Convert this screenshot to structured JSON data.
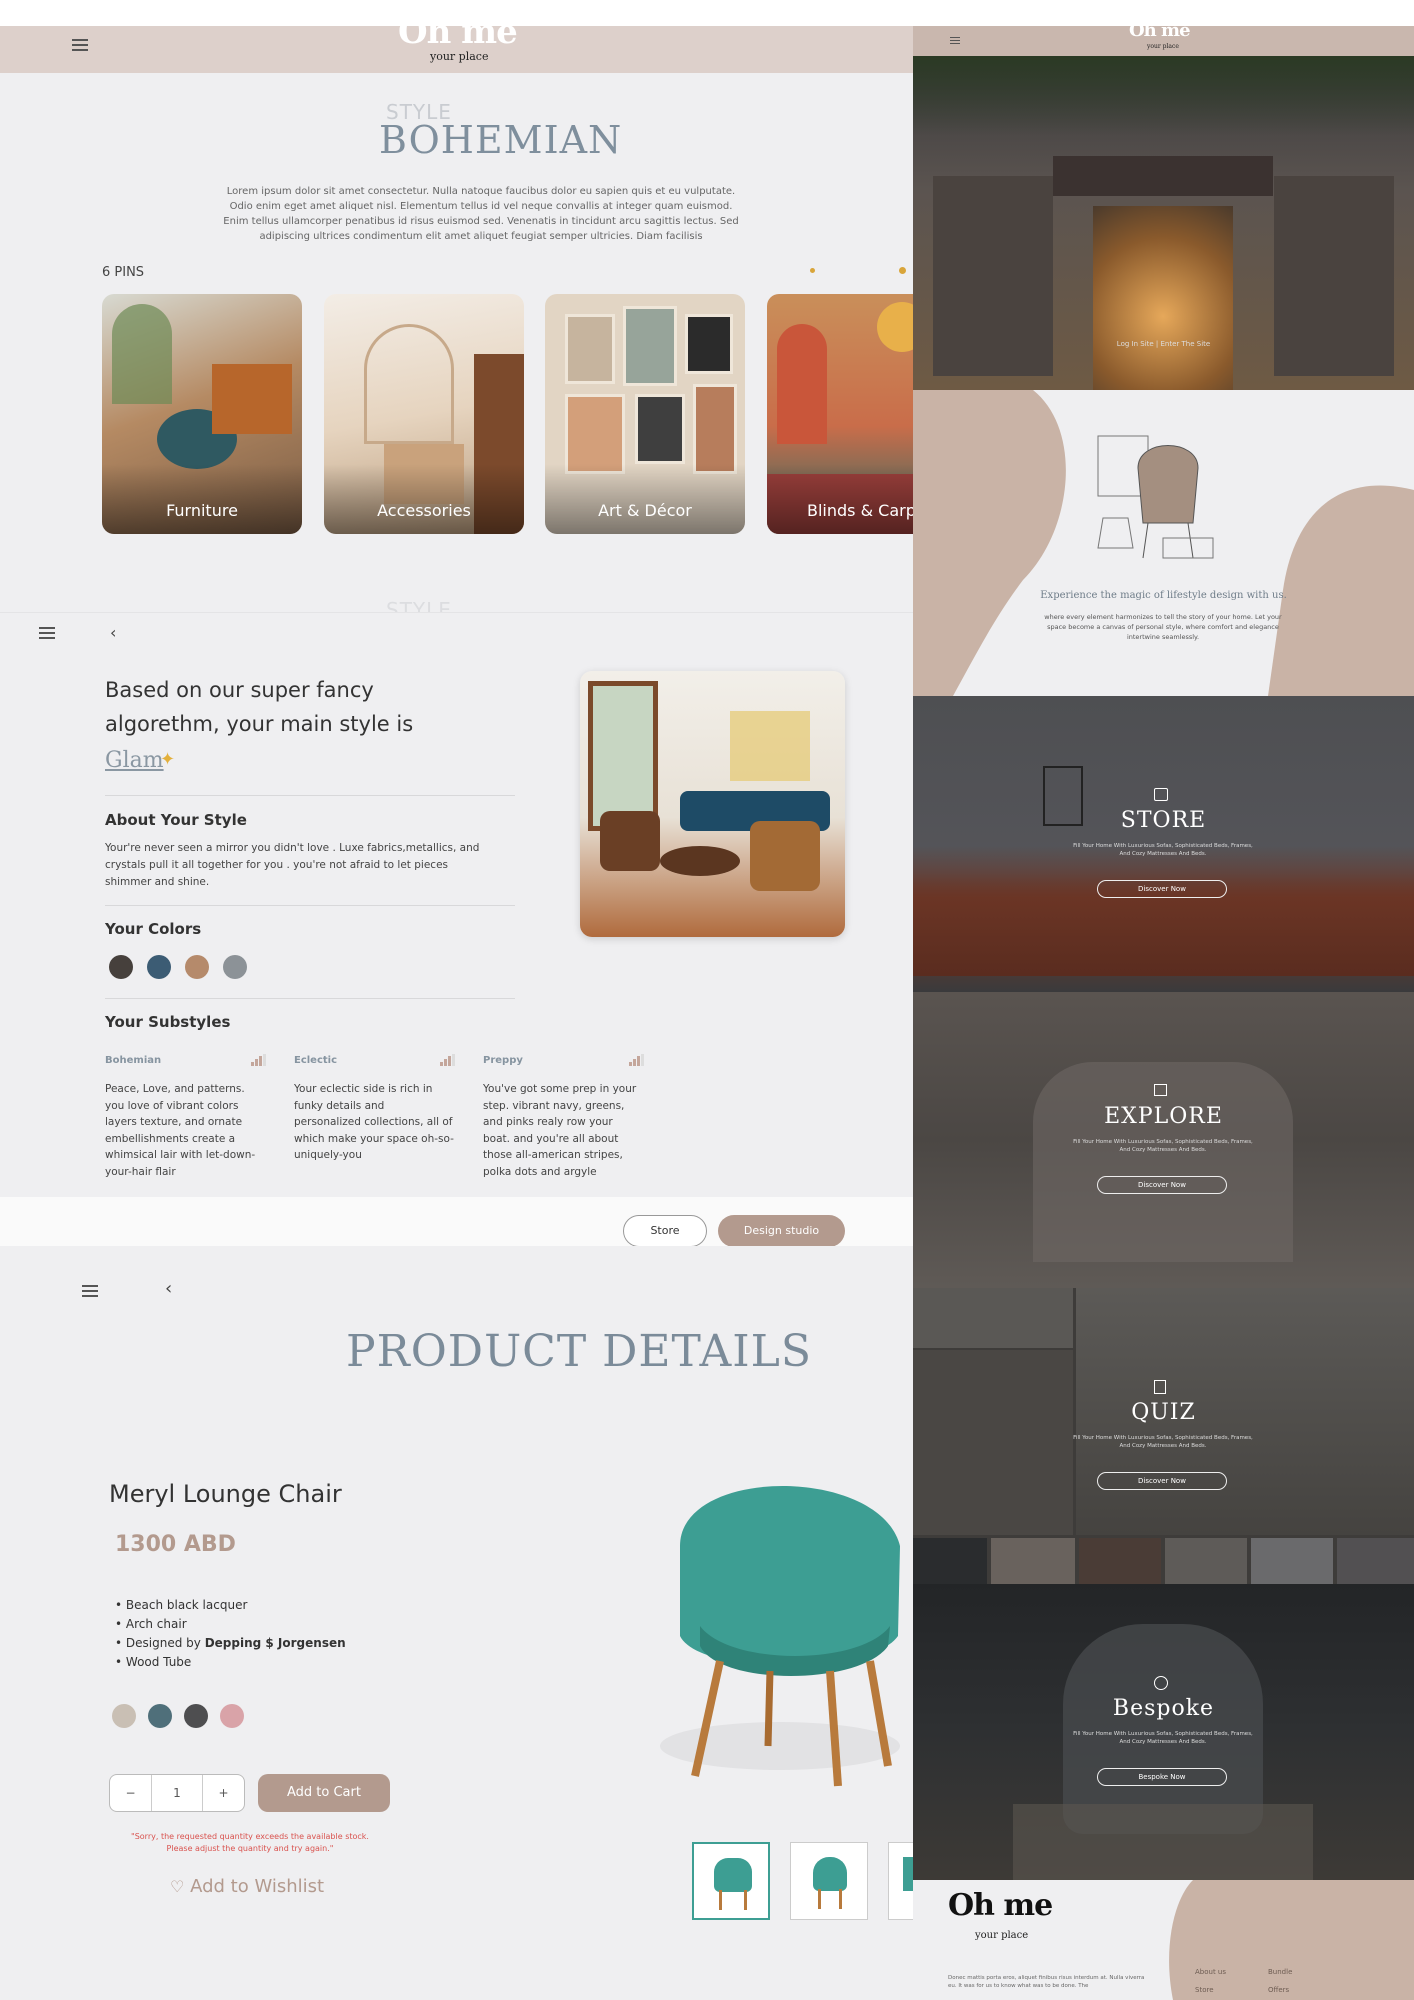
{
  "colors": {
    "accent": "#b39a8e",
    "title_blue": "#7f8f9d",
    "topbar": "#ddd0cb",
    "background": "#efeff1"
  },
  "bohemian": {
    "logo": "Oh me",
    "logo_sub": "your place",
    "style_label": "STYLE",
    "style_name": "BOHEMIAN",
    "description": "Lorem ipsum dolor sit amet consectetur. Nulla natoque faucibus dolor eu sapien quis et eu vulputate. Odio enim eget amet aliquet nisl. Elementum tellus id vel neque convallis at integer quam euismod. Enim tellus ullamcorper penatibus id risus euismod sed. Venenatis in tincidunt arcu sagittis lectus. Sed adipiscing ultrices condimentum elit amet aliquet feugiat semper ultricies. Diam facilisis",
    "pins_count": "6 PINS",
    "cards": [
      "Furniture",
      "Accessories",
      "Art & Décor",
      "Blinds & Carp"
    ],
    "style_label_faded": "STYLE"
  },
  "result": {
    "heading": "Based on our super fancy algorethm, your main style is",
    "style_name": "Glam",
    "about_title": "About Your Style",
    "about_text": "Your're never seen a mirror you didn't love . Luxe fabrics,metallics, and crystals pull it all together for you . you're not afraid to let pieces shimmer and shine.",
    "colors_title": "Your Colors",
    "swatches": [
      "#46403c",
      "#3c5c74",
      "#b58a6b",
      "#8c9297"
    ],
    "substyles_title": "Your Substyles",
    "substyles": [
      {
        "name": "Bohemian",
        "text": "Peace, Love, and patterns. you love of vibrant colors layers texture, and ornate embellishments create a whimsical lair with let-down-your-hair flair"
      },
      {
        "name": "Eclectic",
        "text": "Your eclectic side is rich in funky details and personalized collections, all of which make your space oh-so-uniquely-you"
      },
      {
        "name": "Preppy",
        "text": "You've got some prep in your step. vibrant navy, greens, and pinks realy row your boat. and you're all about those all-american stripes, polka dots and argyle"
      }
    ],
    "btn_store": "Store",
    "btn_design": "Design studio"
  },
  "product": {
    "page_title": "PRODUCT DETAILS",
    "name": "Meryl Lounge Chair",
    "price": "1300 ABD",
    "features": [
      "Beach black lacquer",
      "Arch chair",
      "Designed by",
      "Wood Tube"
    ],
    "designer": "Depping $ Jorgensen",
    "color_options": [
      "#c9bfb4",
      "#4f6f7a",
      "#4e4e50",
      "#d9a3a8"
    ],
    "qty_minus": "−",
    "qty_value": "1",
    "qty_plus": "+",
    "add_to_cart": "Add to Cart",
    "stock_message_1": "\"Sorry, the requested quantity exceeds the available stock.",
    "stock_message_2": "Please adjust the quantity and try again.\"",
    "wishlist": "Add to Wishlist"
  },
  "right": {
    "logo": "Oh me",
    "logo_sub": "your place",
    "hero_links": "Log In Site  |  Enter The Site",
    "about_heading": "Experience the magic of lifestyle design with us.",
    "about_text": "where every element harmonizes to tell the story of your home. Let your space become a canvas of personal style, where comfort and elegance intertwine seamlessly.",
    "sections": [
      {
        "title": "STORE",
        "sub": "Fill Your Home With Luxurious Sofas, Sophisticated Beds, Frames, And Cozy Mattresses And Beds.",
        "button": "Discover Now"
      },
      {
        "title": "EXPLORE",
        "sub": "Fill Your Home With Luxurious Sofas, Sophisticated Beds, Frames, And Cozy Mattresses And Beds.",
        "button": "Discover Now"
      },
      {
        "title": "QUIZ",
        "sub": "Fill Your Home With Luxurious Sofas, Sophisticated Beds, Frames, And Cozy Mattresses And Beds.",
        "button": "Discover Now"
      },
      {
        "title": "Bespoke",
        "sub": "Fill Your Home With Luxurious Sofas, Sophisticated Beds, Frames, And Cozy Mattresses And Beds.",
        "button": "Bespoke Now"
      }
    ],
    "footer_logo": "Oh me",
    "footer_logo_sub": "your place",
    "footer_text": "Donec mattis porta eros, aliquet finibus risus interdum at. Nulla viverra eu. It was for us to know what was to be done. The",
    "footer_links": [
      "About us",
      "Bundle",
      "Store",
      "Offers"
    ]
  }
}
